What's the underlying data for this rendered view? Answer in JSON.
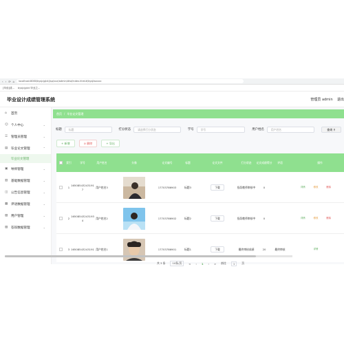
{
  "browser": {
    "nav_icons": [
      "‹",
      "›",
      "⟳",
      "⌂"
    ],
    "url": "localhost:8080/bysjcjglxt/jsp/vue/admin/dist/index.html#/bysjlwxxxx",
    "tabs": [
      "[毕设]成...",
      "bysjcjglxt 毕业之..."
    ]
  },
  "header": {
    "title": "毕业设计成绩管理系统",
    "user": "管理员 admin",
    "logout": "退出"
  },
  "sidebar": {
    "items": [
      {
        "icon": "home-icon",
        "glyph": "⌂",
        "label": "首页"
      },
      {
        "icon": "user-icon",
        "glyph": "☺",
        "label": "个人中心"
      },
      {
        "icon": "admin-icon",
        "glyph": "☰",
        "label": "管理员管理"
      },
      {
        "icon": "paper-icon",
        "glyph": "▤",
        "label": "毕业论文管理"
      },
      {
        "icon": "teacher-icon",
        "glyph": "▣",
        "label": "导师管理"
      },
      {
        "icon": "data-icon",
        "glyph": "▥",
        "label": "基础数据管理"
      },
      {
        "icon": "notice-icon",
        "glyph": "◫",
        "label": "公告信息管理"
      },
      {
        "icon": "review-icon",
        "glyph": "▦",
        "label": "评语数据管理"
      },
      {
        "icon": "users-icon",
        "glyph": "▧",
        "label": "用户管理"
      },
      {
        "icon": "reply-icon",
        "glyph": "▨",
        "label": "答辩数据管理"
      }
    ],
    "submenu_label": "毕业论文管理"
  },
  "breadcrumb": {
    "home": "首页",
    "current": "毕业论文管理"
  },
  "search": {
    "title_label": "标题",
    "title_placeholder": "标题",
    "status_label": "打分状态",
    "status_placeholder": "请选择打分状态",
    "student_label": "学号",
    "student_placeholder": "学号",
    "user_label": "用户姓名",
    "user_placeholder": "用户姓名",
    "search_button": "查询 ⚲"
  },
  "actions": {
    "add": "+ 新增",
    "delete": "⊘ 删除",
    "export": "+ 导出"
  },
  "table": {
    "headers": [
      "",
      "索引",
      "学号",
      "用户姓名",
      "头像",
      "论文编号",
      "标题",
      "论文文件",
      "打分状态",
      "论文成绩得分",
      "评语",
      "操作"
    ],
    "rows": [
      {
        "index": "1",
        "student_id": "16508543243191 7",
        "name": "用户姓名3",
        "paper_no": "17703786903",
        "title": "标题3",
        "file_button": "下载",
        "status": "指导教师审核中",
        "score": "0",
        "comment": "",
        "ops": [
          "详情",
          "修改",
          "删除"
        ]
      },
      {
        "index": "2",
        "student_id": "16508543243193 4",
        "name": "用户姓名2",
        "paper_no": "17703786902",
        "title": "标题2",
        "file_button": "下载",
        "status": "指导教师审核中",
        "score": "0",
        "comment": "",
        "ops": [
          "详情",
          "修改",
          "删除"
        ]
      },
      {
        "index": "3",
        "student_id": "16508543243191",
        "name": "用户姓名1",
        "paper_no": "17703786901",
        "title": "标题1",
        "file_button": "下载",
        "status": "最终审核成绩",
        "score": "20",
        "comment": "最终审核",
        "ops": [
          "详情"
        ]
      }
    ]
  },
  "pager": {
    "total": "共 3 条",
    "page_size": "10条/页",
    "prev_first": "<",
    "prev": "‹",
    "current": "1",
    "next": "›",
    "next_last": ">",
    "goto_label": "前往",
    "goto_value": "1",
    "page_suffix": "页"
  }
}
